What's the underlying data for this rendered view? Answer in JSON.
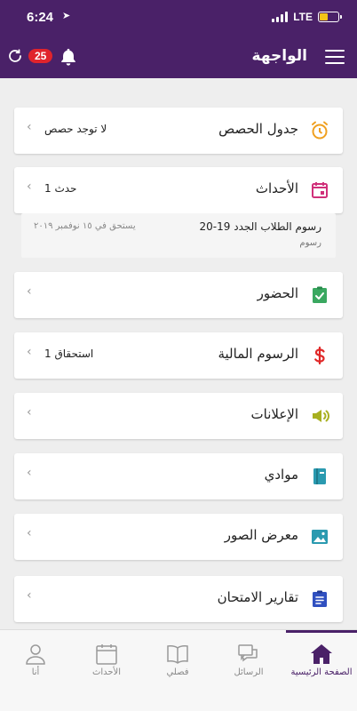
{
  "status": {
    "time": "6:24",
    "network": "LTE"
  },
  "header": {
    "title": "الواجهة",
    "notification_count": "25"
  },
  "cards": [
    {
      "id": "timetable",
      "title": "جدول الحصص",
      "value": "لا توجد حصص",
      "icon": "alarm-clock-icon",
      "color": "#f0a020"
    },
    {
      "id": "events",
      "title": "الأحداث",
      "value": "1 حدث",
      "icon": "calendar-icon",
      "color": "#d0307a"
    },
    {
      "id": "attendance",
      "title": "الحضور",
      "value": "",
      "icon": "clipboard-check-icon",
      "color": "#3aa860"
    },
    {
      "id": "fees",
      "title": "الرسوم المالية",
      "value": "1 استحقاق",
      "icon": "dollar-icon",
      "color": "#e02828"
    },
    {
      "id": "announcements",
      "title": "الإعلانات",
      "value": "",
      "icon": "megaphone-icon",
      "color": "#a8b020"
    },
    {
      "id": "subjects",
      "title": "موادي",
      "value": "",
      "icon": "book-icon",
      "color": "#2a9ab0"
    },
    {
      "id": "gallery",
      "title": "معرض الصور",
      "value": "",
      "icon": "image-icon",
      "color": "#2a9ab0"
    },
    {
      "id": "exam_reports",
      "title": "تقارير الامتحان",
      "value": "",
      "icon": "clipboard-list-icon",
      "color": "#3050c0"
    }
  ],
  "event_item": {
    "title": "رسوم الطلاب الجدد 19-20",
    "subtitle": "رسوم",
    "due": "يستحق في ١٥ نوفمبر ٢٠١٩"
  },
  "tabs": [
    {
      "id": "home",
      "label": "الصفحة الرئيسية",
      "icon": "home-icon"
    },
    {
      "id": "messages",
      "label": "الرسائل",
      "icon": "chat-icon"
    },
    {
      "id": "classroom",
      "label": "فصلي",
      "icon": "open-book-icon"
    },
    {
      "id": "events",
      "label": "الأحداث",
      "icon": "calendar-icon"
    },
    {
      "id": "me",
      "label": "أنا",
      "icon": "person-icon"
    }
  ],
  "colors": {
    "brand": "#4a2168",
    "badge": "#e0242c"
  }
}
